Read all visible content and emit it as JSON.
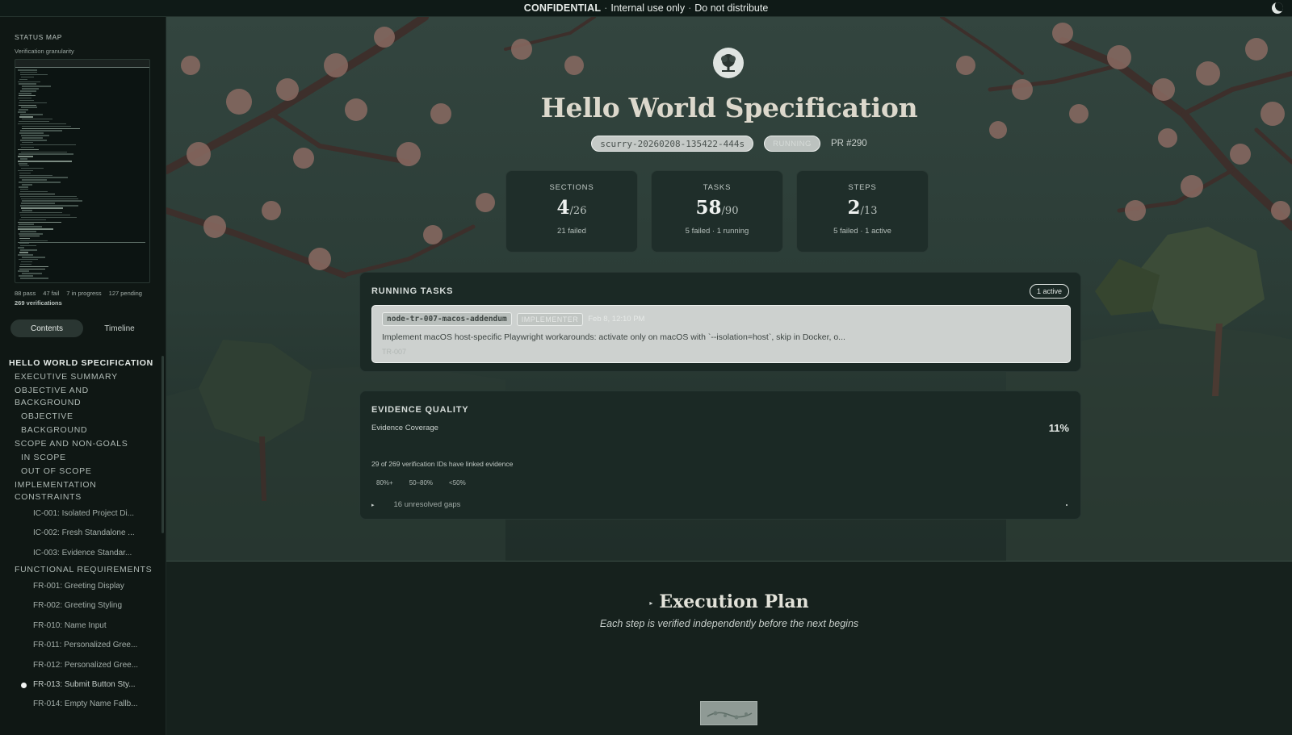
{
  "banner": {
    "confidential": "CONFIDENTIAL",
    "text1": "Internal use only",
    "text2": "Do not distribute",
    "sep": "·",
    "theme_icon": "moon-icon"
  },
  "sidebar": {
    "status_map_title": "STATUS MAP",
    "status_map_subtitle": "Verification granularity",
    "stats": {
      "pass": "88 pass",
      "fail": "47 fail",
      "in_progress": "7 in progress",
      "pending": "127 pending",
      "total": "269 verifications"
    },
    "tabs": {
      "contents": "Contents",
      "timeline": "Timeline",
      "active": "contents"
    },
    "toc": {
      "hello": "HELLO WORLD SPECIFICATION",
      "exec_summary": "EXECUTIVE SUMMARY",
      "objective_bg_1": "OBJECTIVE AND",
      "objective_bg_2": "BACKGROUND",
      "objective": "OBJECTIVE",
      "background": "BACKGROUND",
      "scope": "SCOPE AND NON-GOALS",
      "in_scope": "IN SCOPE",
      "out_scope": "OUT OF SCOPE",
      "impl_1": "IMPLEMENTATION",
      "impl_2": "CONSTRAINTS",
      "ic001": "IC-001: Isolated Project Di...",
      "ic002": "IC-002: Fresh Standalone ...",
      "ic003": "IC-003: Evidence Standar...",
      "func_req": "FUNCTIONAL REQUIREMENTS",
      "fr001": "FR-001: Greeting Display",
      "fr002": "FR-002: Greeting Styling",
      "fr010": "FR-010: Name Input",
      "fr011": "FR-011: Personalized Gree...",
      "fr012": "FR-012: Personalized Gree...",
      "fr013": "FR-013: Submit Button Sty...",
      "fr014": "FR-014: Empty Name Fallb..."
    }
  },
  "header": {
    "title": "Hello World Specification",
    "run_id": "scurry-20260208-135422-444s",
    "status": "RUNNING",
    "pr": "PR #290"
  },
  "stats": {
    "sections": {
      "label": "SECTIONS",
      "value": "4",
      "total": "/26",
      "detail": "21 failed"
    },
    "tasks": {
      "label": "TASKS",
      "value": "58",
      "total": "/90",
      "detail": "5 failed · 1 running"
    },
    "steps": {
      "label": "STEPS",
      "value": "2",
      "total": "/13",
      "detail": "5 failed · 1 active"
    }
  },
  "running_tasks": {
    "title": "RUNNING TASKS",
    "badge": "1 active",
    "task": {
      "id": "node-tr-007-macos-addendum",
      "role": "IMPLEMENTER",
      "time": "Feb 8, 12:10 PM",
      "description": "Implement macOS host-specific Playwright workarounds: activate only on macOS with `--isolation=host`, skip in Docker, o...",
      "ref": "TR-007"
    }
  },
  "evidence": {
    "title": "EVIDENCE QUALITY",
    "coverage_label": "Evidence Coverage",
    "coverage_pct": "11%",
    "coverage_fraction": 0.11,
    "linked": "29 of 269 verification IDs have linked evidence",
    "legend": [
      "80%+",
      "50–80%",
      "<50%"
    ],
    "gaps": "16 unresolved gaps",
    "caret": "▸"
  },
  "execution_plan": {
    "title": "Execution Plan",
    "arrow": "▸",
    "subtitle": "Each step is verified independently before the next begins"
  },
  "colors": {
    "background": "#14201c",
    "sidebar": "#0f1714",
    "card": "#1f2e2a",
    "task_card": "#cdd1cf",
    "title": "#dcd8cc"
  }
}
